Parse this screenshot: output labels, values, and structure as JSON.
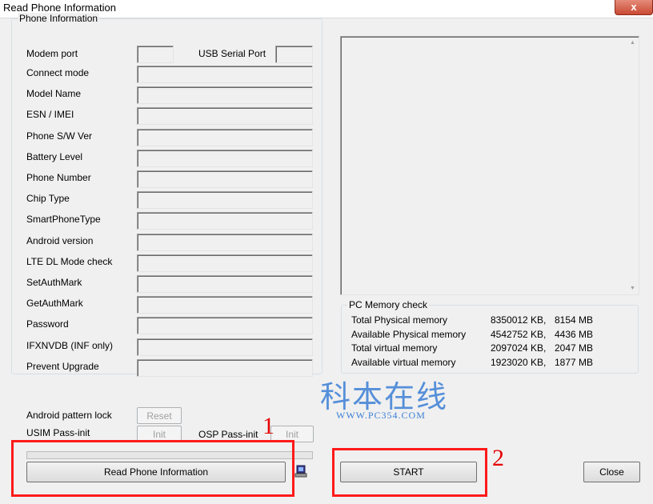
{
  "window": {
    "title": "Read Phone Information",
    "close_glyph": "x"
  },
  "phone_info": {
    "group_title": "Phone Information",
    "modem_port_label": "Modem port",
    "usb_serial_port_label": "USB Serial Port",
    "fields": [
      "Connect mode",
      "Model Name",
      "ESN / IMEI",
      "Phone S/W Ver",
      "Battery Level",
      "Phone Number",
      "Chip Type",
      "SmartPhoneType",
      "Android version",
      "LTE DL Mode check",
      "SetAuthMark",
      "GetAuthMark",
      "Password",
      "IFXNVDB (INF only)",
      "Prevent Upgrade"
    ],
    "android_pattern_lock_label": "Android pattern lock",
    "reset_label": "Reset",
    "usim_label": "USIM Pass-init",
    "usim_init_label": "Init",
    "osp_label": "OSP Pass-init",
    "osp_init_label": "Init"
  },
  "pc_memory": {
    "group_title": "PC Memory check",
    "rows": [
      {
        "label": "Total Physical memory",
        "kb": "8350012 KB,",
        "mb": "8154 MB"
      },
      {
        "label": "Available Physical memory",
        "kb": "4542752 KB,",
        "mb": "4436 MB"
      },
      {
        "label": "Total virtual memory",
        "kb": "2097024 KB,",
        "mb": "2047 MB"
      },
      {
        "label": "Available virtual memory",
        "kb": "1923020 KB,",
        "mb": "1877 MB"
      }
    ]
  },
  "buttons": {
    "read_phone_info": "Read Phone Information",
    "start": "START",
    "close": "Close"
  },
  "annotations": {
    "marker_1": "1",
    "marker_2": "2"
  },
  "watermark": {
    "text": "WWW.PC354.COM",
    "glyphs": "科本在线"
  },
  "colors": {
    "annotation_red": "#ff1a1a",
    "watermark_blue": "#3b7fd6"
  }
}
